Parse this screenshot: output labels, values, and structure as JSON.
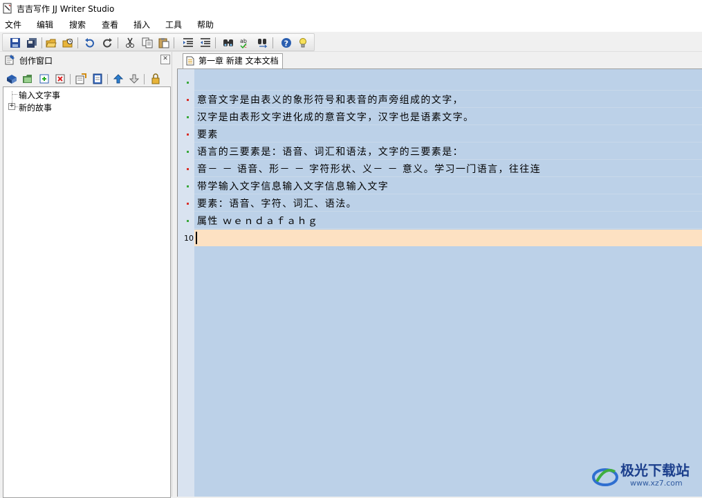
{
  "window": {
    "title": "吉吉写作 JJ Writer Studio"
  },
  "menu": [
    "文件",
    "编辑",
    "搜索",
    "查看",
    "插入",
    "工具",
    "帮助"
  ],
  "toolbar_icons": [
    "save-icon",
    "save-all-icon",
    "open-icon",
    "open-recent-icon",
    "undo-icon",
    "redo-icon",
    "cut-icon",
    "copy-icon",
    "paste-icon",
    "indent-icon",
    "outdent-icon",
    "find-icon",
    "spell-check-icon",
    "replace-icon",
    "help-icon",
    "tip-icon"
  ],
  "left_panel": {
    "title": "创作窗口",
    "tree": [
      {
        "label": "输入文字事",
        "expandable": false
      },
      {
        "label": "新的故事",
        "expandable": true,
        "expander_symbol": "+"
      }
    ]
  },
  "editor": {
    "tab_label": "第一章 新建 文本文档",
    "lines": [
      {
        "text": ""
      },
      {
        "text": "意音文字是由表义的象形符号和表音的声旁组成的文字，"
      },
      {
        "text": "汉字是由表形文字进化成的意音文字，汉字也是语素文字。"
      },
      {
        "text": "要素"
      },
      {
        "text": "语言的三要素是：语音、词汇和语法，文字的三要素是："
      },
      {
        "text": "音－ － 语音、形－ － 字符形状、义－ － 意义。学习一门语言，往往连"
      },
      {
        "text": "带学输入文字信息输入文字信息输入文字"
      },
      {
        "text": "要素：语音、字符、词汇、语法。"
      },
      {
        "text": "属性 ｗｅｎｄａｆａｈｇ"
      }
    ],
    "current_line_number": "10",
    "gutter_mark_colors": {
      "red": "#d9302a",
      "green": "#3aa83a"
    }
  },
  "watermark": {
    "text": "极光下载站",
    "url": "www.xz7.com"
  }
}
